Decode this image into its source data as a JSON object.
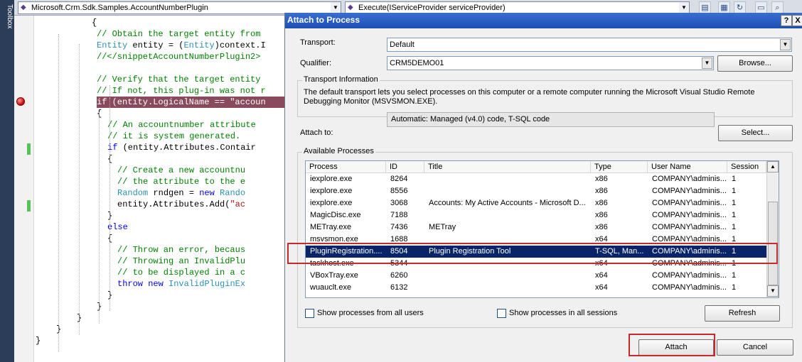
{
  "ide": {
    "toolbox_label": "Toolbox",
    "nav": {
      "type_combo": "Microsoft.Crm.Sdk.Samples.AccountNumberPlugin",
      "member_combo": "Execute(IServiceProvider serviceProvider)"
    },
    "tool_icons": [
      "class-view-icon",
      "properties-icon",
      "refresh-icon",
      "document-icon",
      "outline-icon"
    ],
    "code_lines": [
      {
        "indent": 11,
        "parts": [
          {
            "t": "{",
            "c": ""
          }
        ]
      },
      {
        "indent": 12,
        "parts": [
          {
            "t": "// Obtain the target entity from",
            "c": "cm"
          }
        ]
      },
      {
        "indent": 12,
        "parts": [
          {
            "t": "Entity",
            "c": "ty"
          },
          {
            "t": " entity = (",
            "c": ""
          },
          {
            "t": "Entity",
            "c": "ty"
          },
          {
            "t": ")context.I",
            "c": ""
          }
        ]
      },
      {
        "indent": 12,
        "parts": [
          {
            "t": "//</snippetAccountNumberPlugin2>",
            "c": "cm"
          }
        ]
      },
      {
        "indent": 0,
        "parts": [
          {
            "t": "",
            "c": ""
          }
        ]
      },
      {
        "indent": 12,
        "parts": [
          {
            "t": "// Verify that the target entity",
            "c": "cm"
          }
        ]
      },
      {
        "indent": 12,
        "parts": [
          {
            "t": "// If not, this plug-in was not r",
            "c": "cm"
          }
        ]
      },
      {
        "indent": 12,
        "hl": true,
        "parts": [
          {
            "t": "if (entity.LogicalName == \"accoun",
            "c": ""
          }
        ]
      },
      {
        "indent": 12,
        "parts": [
          {
            "t": "{",
            "c": ""
          }
        ]
      },
      {
        "indent": 14,
        "parts": [
          {
            "t": "// An accountnumber attribute",
            "c": "cm"
          }
        ]
      },
      {
        "indent": 14,
        "parts": [
          {
            "t": "// it is system generated.",
            "c": "cm"
          }
        ]
      },
      {
        "indent": 14,
        "parts": [
          {
            "t": "if",
            "c": "kw"
          },
          {
            "t": " (entity.Attributes.Contair",
            "c": ""
          }
        ]
      },
      {
        "indent": 14,
        "parts": [
          {
            "t": "{",
            "c": ""
          }
        ]
      },
      {
        "indent": 16,
        "parts": [
          {
            "t": "// Create a new accountnu",
            "c": "cm"
          }
        ]
      },
      {
        "indent": 16,
        "parts": [
          {
            "t": "// the attribute to the e",
            "c": "cm"
          }
        ]
      },
      {
        "indent": 16,
        "parts": [
          {
            "t": "Random",
            "c": "ty"
          },
          {
            "t": " rndgen = ",
            "c": ""
          },
          {
            "t": "new",
            "c": "kw"
          },
          {
            "t": " ",
            "c": ""
          },
          {
            "t": "Rando",
            "c": "ty"
          }
        ]
      },
      {
        "indent": 16,
        "parts": [
          {
            "t": "entity.Attributes.Add(",
            "c": ""
          },
          {
            "t": "\"ac",
            "c": "st"
          }
        ]
      },
      {
        "indent": 14,
        "parts": [
          {
            "t": "}",
            "c": ""
          }
        ]
      },
      {
        "indent": 14,
        "parts": [
          {
            "t": "else",
            "c": "kw"
          }
        ]
      },
      {
        "indent": 14,
        "parts": [
          {
            "t": "{",
            "c": ""
          }
        ]
      },
      {
        "indent": 16,
        "parts": [
          {
            "t": "// Throw an error, becaus",
            "c": "cm"
          }
        ]
      },
      {
        "indent": 16,
        "parts": [
          {
            "t": "// Throwing an InvalidPlu",
            "c": "cm"
          }
        ]
      },
      {
        "indent": 16,
        "parts": [
          {
            "t": "// to be displayed in a c",
            "c": "cm"
          }
        ]
      },
      {
        "indent": 16,
        "parts": [
          {
            "t": "throw",
            "c": "kw"
          },
          {
            "t": " ",
            "c": ""
          },
          {
            "t": "new",
            "c": "kw"
          },
          {
            "t": " ",
            "c": ""
          },
          {
            "t": "InvalidPluginEx",
            "c": "ty"
          }
        ]
      },
      {
        "indent": 14,
        "parts": [
          {
            "t": "}",
            "c": ""
          }
        ]
      },
      {
        "indent": 12,
        "parts": [
          {
            "t": "}",
            "c": ""
          }
        ]
      },
      {
        "indent": 8,
        "parts": [
          {
            "t": "}",
            "c": ""
          }
        ]
      },
      {
        "indent": 4,
        "parts": [
          {
            "t": "}",
            "c": ""
          }
        ]
      },
      {
        "indent": 0,
        "parts": [
          {
            "t": "}",
            "c": ""
          }
        ]
      }
    ]
  },
  "dialog": {
    "title": "Attach to Process",
    "help_label": "?",
    "close_label": "X",
    "transport_label": "Transport:",
    "transport_value": "Default",
    "qualifier_label": "Qualifier:",
    "qualifier_value": "CRM5DEMO01",
    "browse_label": "Browse...",
    "transport_info_title": "Transport Information",
    "transport_info_text": "The default transport lets you select processes on this computer or a remote computer running the Microsoft Visual Studio Remote Debugging Monitor (MSVSMON.EXE).",
    "attach_to_label": "Attach to:",
    "attach_to_value": "Automatic: Managed (v4.0) code, T-SQL code",
    "select_label": "Select...",
    "available_title": "Available Processes",
    "columns": [
      "Process",
      "ID",
      "Title",
      "Type",
      "User Name",
      "Session"
    ],
    "processes": [
      {
        "process": "iexplore.exe",
        "id": "8264",
        "title": "",
        "type": "x86",
        "user": "COMPANY\\adminis...",
        "session": "1"
      },
      {
        "process": "iexplore.exe",
        "id": "8556",
        "title": "",
        "type": "x86",
        "user": "COMPANY\\adminis...",
        "session": "1"
      },
      {
        "process": "iexplore.exe",
        "id": "3068",
        "title": "Accounts: My Active Accounts - Microsoft D...",
        "type": "x86",
        "user": "COMPANY\\adminis...",
        "session": "1"
      },
      {
        "process": "MagicDisc.exe",
        "id": "7188",
        "title": "",
        "type": "x86",
        "user": "COMPANY\\adminis...",
        "session": "1"
      },
      {
        "process": "METray.exe",
        "id": "7436",
        "title": "METray",
        "type": "x86",
        "user": "COMPANY\\adminis...",
        "session": "1"
      },
      {
        "process": "msvsmon.exe",
        "id": "1688",
        "title": "",
        "type": "x64",
        "user": "COMPANY\\adminis...",
        "session": "1"
      },
      {
        "process": "PluginRegistration....",
        "id": "8504",
        "title": "Plugin Registration Tool",
        "type": "T-SQL, Man...",
        "user": "COMPANY\\adminis...",
        "session": "1",
        "selected": true
      },
      {
        "process": "taskhost.exe",
        "id": "5344",
        "title": "",
        "type": "x64",
        "user": "COMPANY\\adminis...",
        "session": "1"
      },
      {
        "process": "VBoxTray.exe",
        "id": "6260",
        "title": "",
        "type": "x64",
        "user": "COMPANY\\adminis...",
        "session": "1"
      },
      {
        "process": "wuauclt.exe",
        "id": "6132",
        "title": "",
        "type": "x64",
        "user": "COMPANY\\adminis...",
        "session": "1"
      }
    ],
    "show_all_users_label": "Show processes from all users",
    "show_all_sessions_label": "Show processes in all sessions",
    "refresh_label": "Refresh",
    "attach_label": "Attach",
    "cancel_label": "Cancel"
  }
}
